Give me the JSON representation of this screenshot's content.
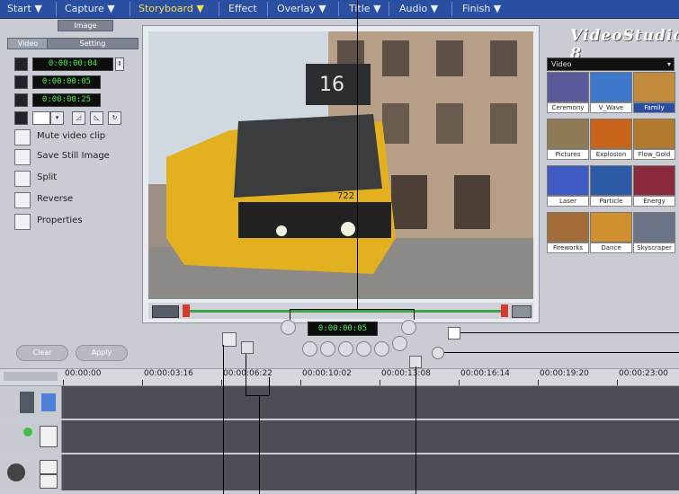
{
  "menu": {
    "items": [
      {
        "label": "Start ▼",
        "active": false
      },
      {
        "label": "Capture ▼",
        "active": false
      },
      {
        "label": "Storyboard ▼",
        "active": true
      },
      {
        "label": "Effect",
        "active": false
      },
      {
        "label": "Overlay ▼",
        "active": false
      },
      {
        "label": "Title ▼",
        "active": false
      },
      {
        "label": "Audio ▼",
        "active": false
      },
      {
        "label": "Finish ▼",
        "active": false
      }
    ]
  },
  "left_panel": {
    "tab_top": "Image",
    "tab_left": "Video",
    "tab_right": "Setting",
    "timecodes": [
      "0:00:00:04",
      "0:00:00:05",
      "0:00:00:25"
    ],
    "options": [
      {
        "label": "Mute video clip",
        "icon": "speaker-icon"
      },
      {
        "label": "Save Still Image",
        "icon": "camera-icon"
      },
      {
        "label": "Split",
        "icon": "split-icon"
      },
      {
        "label": "Reverse",
        "icon": "reverse-icon"
      },
      {
        "label": "Properties",
        "icon": "properties-icon"
      }
    ],
    "buttons": {
      "left": "Clear",
      "right": "Apply"
    }
  },
  "preview": {
    "timecode": "0:00:00:05",
    "tram_number": "16",
    "tram_side_number": "722"
  },
  "album": {
    "logo": "VideoStudio 8",
    "dropdown": "Video",
    "thumbnails": [
      {
        "label": "Ceremony",
        "color": "#5b5a9a",
        "selected": false
      },
      {
        "label": "V_Wave",
        "color": "#3d78cc",
        "selected": false
      },
      {
        "label": "Family",
        "color": "#c28a3a",
        "selected": true
      },
      {
        "label": "Pictures",
        "color": "#8e7a54",
        "selected": false
      },
      {
        "label": "Explosion",
        "color": "#c8651a",
        "selected": false
      },
      {
        "label": "Flow_Gold",
        "color": "#b27a2c",
        "selected": false
      },
      {
        "label": "Laser",
        "color": "#3f5ac2",
        "selected": false
      },
      {
        "label": "Particle",
        "color": "#2d5ba7",
        "selected": false
      },
      {
        "label": "Energy",
        "color": "#8a2a3c",
        "selected": false
      },
      {
        "label": "Fireworks",
        "color": "#a36d3a",
        "selected": false
      },
      {
        "label": "Dance",
        "color": "#d19030",
        "selected": false
      },
      {
        "label": "Skyscraper",
        "color": "#6b7486",
        "selected": false
      }
    ]
  },
  "ruler": {
    "labels": [
      "00:00:00",
      "00:00:03:16",
      "00:00:06:22",
      "00:00:10:02",
      "00:00:13:08",
      "00:00:16:14",
      "00:00:19:20",
      "00:00:23:00"
    ]
  }
}
